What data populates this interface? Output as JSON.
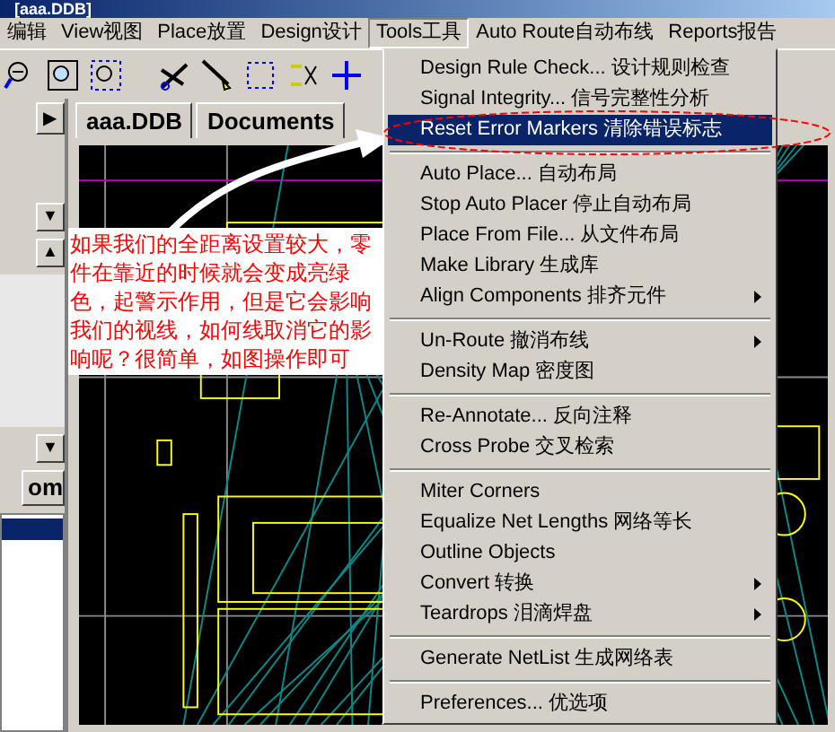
{
  "window": {
    "title": "[aaa.DDB]"
  },
  "menubar": [
    {
      "label": "编辑",
      "selected": false
    },
    {
      "label": "View视图",
      "selected": false
    },
    {
      "label": "Place放置",
      "selected": false
    },
    {
      "label": "Design设计",
      "selected": false
    },
    {
      "label": "Tools工具",
      "selected": true
    },
    {
      "label": "Auto Route自动布线",
      "selected": false
    },
    {
      "label": "Reports报告",
      "selected": false
    }
  ],
  "left_panel": {
    "nav_arrow": "▶",
    "dropdown_arrows": [
      "▼",
      "▼"
    ],
    "scroll_arrow": "▲",
    "zoom_button": "om"
  },
  "tabs": [
    {
      "label": "aaa.DDB",
      "selected": false
    },
    {
      "label": "Documents",
      "selected": false
    }
  ],
  "annotation": {
    "text": "如果我们的全距离设置较大，零件在靠近的时候就会变成亮绿色，起警示作用，但是它会影响我们的视线，如何线取消它的影响呢？很简单，如图操作即可"
  },
  "tools_menu": {
    "items": [
      {
        "kind": "item",
        "label": "Design Rule Check... 设计规则检查",
        "selected": false,
        "submenu": false
      },
      {
        "kind": "item",
        "label": "Signal Integrity... 信号完整性分析",
        "selected": false,
        "submenu": false
      },
      {
        "kind": "item",
        "label": "Reset Error Markers 清除错误标志",
        "selected": true,
        "submenu": false
      },
      {
        "kind": "separator"
      },
      {
        "kind": "item",
        "label": "Auto Place... 自动布局",
        "selected": false,
        "submenu": false
      },
      {
        "kind": "item",
        "label": "Stop Auto Placer 停止自动布局",
        "selected": false,
        "submenu": false
      },
      {
        "kind": "item",
        "label": "Place From File... 从文件布局",
        "selected": false,
        "submenu": false
      },
      {
        "kind": "item",
        "label": "Make Library 生成库",
        "selected": false,
        "submenu": false
      },
      {
        "kind": "item",
        "label": "Align Components 排齐元件",
        "selected": false,
        "submenu": true
      },
      {
        "kind": "separator"
      },
      {
        "kind": "item",
        "label": "Un-Route 撤消布线",
        "selected": false,
        "submenu": true
      },
      {
        "kind": "item",
        "label": "Density Map 密度图",
        "selected": false,
        "submenu": false
      },
      {
        "kind": "separator"
      },
      {
        "kind": "item",
        "label": "Re-Annotate... 反向注释",
        "selected": false,
        "submenu": false
      },
      {
        "kind": "item",
        "label": "Cross Probe 交叉检索",
        "selected": false,
        "submenu": false
      },
      {
        "kind": "separator"
      },
      {
        "kind": "item",
        "label": "Miter Corners",
        "selected": false,
        "submenu": false
      },
      {
        "kind": "item",
        "label": "Equalize Net Lengths 网络等长",
        "selected": false,
        "submenu": false
      },
      {
        "kind": "item",
        "label": "Outline Objects",
        "selected": false,
        "submenu": false
      },
      {
        "kind": "item",
        "label": "Convert 转换",
        "selected": false,
        "submenu": true
      },
      {
        "kind": "item",
        "label": "Teardrops 泪滴焊盘",
        "selected": false,
        "submenu": true
      },
      {
        "kind": "separator"
      },
      {
        "kind": "item",
        "label": "Generate NetList 生成网络表",
        "selected": false,
        "submenu": false
      },
      {
        "kind": "separator"
      },
      {
        "kind": "item",
        "label": "Preferences... 优选项",
        "selected": false,
        "submenu": false
      }
    ]
  }
}
